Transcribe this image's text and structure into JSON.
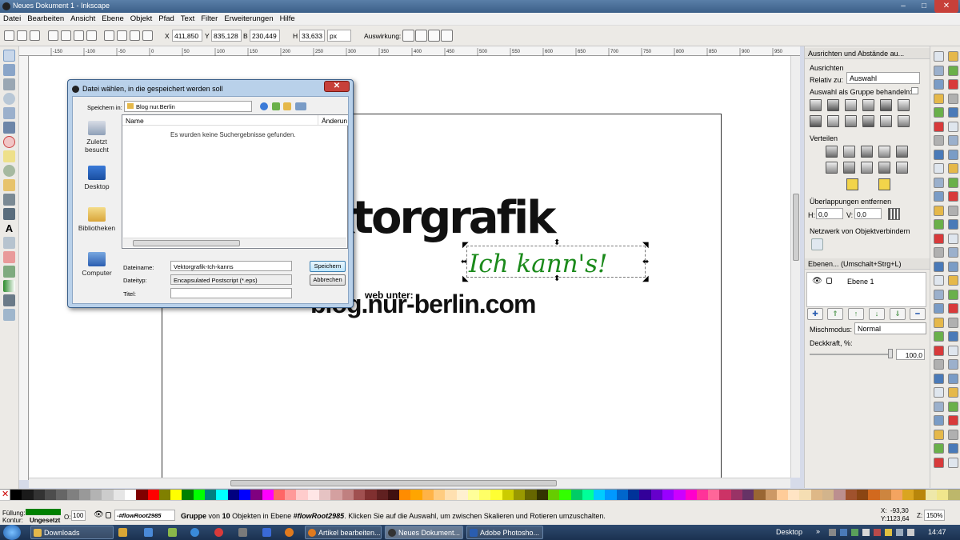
{
  "window": {
    "title": "Neues Dokument 1 - Inkscape",
    "min": "‒",
    "max": "□",
    "close": "✕"
  },
  "menu": [
    "Datei",
    "Bearbeiten",
    "Ansicht",
    "Ebene",
    "Objekt",
    "Pfad",
    "Text",
    "Filter",
    "Erweiterungen",
    "Hilfe"
  ],
  "toolbar": {
    "x_label": "X",
    "x_value": "411,850",
    "y_label": "Y",
    "y_value": "835,128",
    "w_label": "B",
    "w_value": "230,449",
    "h_label": "H",
    "h_value": "33,633",
    "unit": "px",
    "effect_label": "Auswirkung:"
  },
  "canvas": {
    "heading": "ktorgrafik",
    "script_text": "Ich kann's!",
    "web_label": "web unter:",
    "url": "blog.nur-berlin.com"
  },
  "dialog": {
    "title": "Datei wählen, in die gespeichert werden soll",
    "close": "✕",
    "save_in_label": "Speichern in:",
    "save_in_value": "Blog nur.Berlin",
    "places": [
      {
        "label": "Zuletzt besucht",
        "icon": "recent-places-icon"
      },
      {
        "label": "Desktop",
        "icon": "desktop-icon"
      },
      {
        "label": "Bibliotheken",
        "icon": "libraries-icon"
      },
      {
        "label": "Computer",
        "icon": "computer-icon"
      }
    ],
    "col_name": "Name",
    "col_changed": "Änderun",
    "empty_message": "Es wurden keine Suchergebnisse gefunden.",
    "filename_label": "Dateiname:",
    "filename_value": "Vektorgrafik-Ich-kanns",
    "filetype_label": "Dateityp:",
    "filetype_value": "Encapsulated Postscript (*.eps)",
    "title_label": "Titel:",
    "save_button": "Speichern",
    "cancel_button": "Abbrechen"
  },
  "panel": {
    "align_header": "Ausrichten und Abstände au...",
    "align_section": "Ausrichten",
    "relative_label": "Relativ zu:",
    "relative_value": "Auswahl",
    "group_label": "Auswahl als Gruppe behandeln:",
    "distribute_section": "Verteilen",
    "overlap_section": "Überlappungen entfernen",
    "h_label": "H:",
    "h_value": "0,0",
    "v_label": "V:",
    "v_value": "0,0",
    "network_section": "Netzwerk von Objektverbindern",
    "layers_header": "Ebenen... (Umschalt+Strg+L)",
    "layer_name": "Ebene 1",
    "blend_label": "Mischmodus:",
    "blend_value": "Normal",
    "opacity_label": "Deckkraft, %:",
    "opacity_value": "100,0"
  },
  "status": {
    "fill_label": "Füllung:",
    "stroke_label": "Kontur:",
    "stroke_value": "Ungesetzt",
    "opacity_label": "O:",
    "opacity_value": "100",
    "layer_select": "-#flowRoot2985",
    "message_pre": "Gruppe",
    "message_mid1": "von",
    "message_count": "10",
    "message_mid2": "Objekten in Ebene",
    "message_layer": "#flowRoot2985",
    "message_post": ". Klicken Sie auf die Auswahl, um zwischen Skalieren und Rotieren umzuschalten.",
    "cursor_x": "X:  -93,30",
    "cursor_y": "Y:1123,64",
    "zoom_label": "Z:",
    "zoom_value": "150%",
    "fill_color": "#008000"
  },
  "taskbar": {
    "items": [
      {
        "label": "Downloads",
        "color": "#e5b84a"
      },
      {
        "label": "Artikel bearbeiten...",
        "color": "#e07a1e"
      },
      {
        "label": "Neues Dokument...",
        "color": "#333333"
      },
      {
        "label": "Adobe Photosho...",
        "color": "#2a5db0"
      }
    ],
    "desktop": "Desktop",
    "clock": "14:47"
  },
  "ruler_ticks": [
    "-150",
    "-100",
    "-50",
    "0",
    "50",
    "100",
    "150",
    "200",
    "250",
    "300",
    "350",
    "400",
    "450",
    "500",
    "550",
    "600",
    "650",
    "700",
    "750",
    "800",
    "850",
    "900",
    "950"
  ]
}
